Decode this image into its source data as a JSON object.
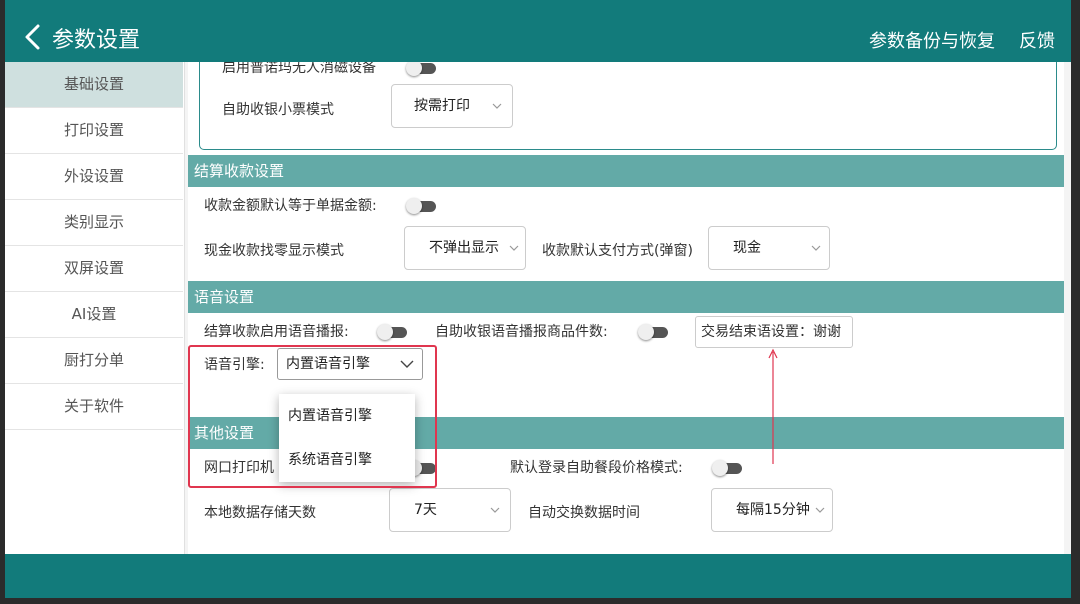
{
  "appbar": {
    "title": "参数设置",
    "backup_label": "参数备份与恢复",
    "feedback_label": "反馈"
  },
  "sidebar": {
    "items": [
      {
        "label": "基础设置",
        "active": true
      },
      {
        "label": "打印设置"
      },
      {
        "label": "外设设置"
      },
      {
        "label": "类别显示"
      },
      {
        "label": "双屏设置"
      },
      {
        "label": "AI设置"
      },
      {
        "label": "厨打分单"
      },
      {
        "label": "关于软件"
      }
    ]
  },
  "top_card": {
    "partial_toggle_label": "启用普诺玛无人消磁设备",
    "self_service_receipt_label": "自助收银小票模式",
    "self_service_receipt_value": "按需打印"
  },
  "settlement": {
    "title": "结算收款设置",
    "default_amount_label": "收款金额默认等于单据金额:",
    "cash_change_label": "现金收款找零显示模式",
    "cash_change_value": "不弹出显示",
    "default_payment_label": "收款默认支付方式(弹窗)",
    "default_payment_value": "现金"
  },
  "voice": {
    "title": "语音设置",
    "settlement_voice_label": "结算收款启用语音播报:",
    "self_service_voice_label": "自助收银语音播报商品件数:",
    "end_phrase_text": "交易结束语设置：谢谢",
    "engine_label": "语音引擎:",
    "engine_value": "内置语音引擎",
    "engine_options": [
      "内置语音引擎",
      "系统语音引擎"
    ]
  },
  "other": {
    "title": "其他设置",
    "network_printer_label": "网口打印机",
    "default_login_label": "默认登录自助餐段价格模式:",
    "storage_days_label": "本地数据存储天数",
    "storage_days_value": "7天",
    "auto_exchange_label": "自动交换数据时间",
    "auto_exchange_value": "每隔15分钟"
  },
  "colors": {
    "primary": "#127b7b",
    "section_header": "#63aaa7",
    "sidebar_active": "#cfe0df",
    "annotation_red": "#e0364f"
  }
}
